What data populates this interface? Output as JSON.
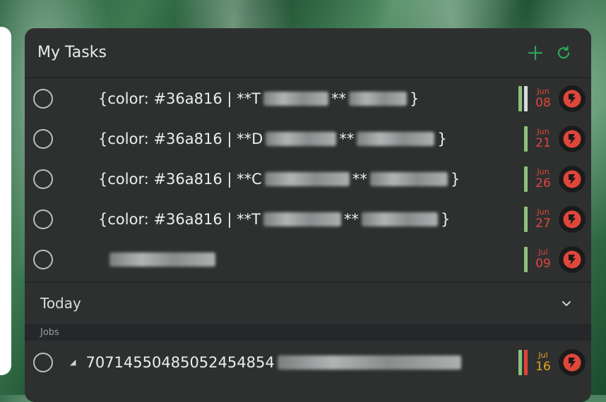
{
  "header": {
    "title": "My Tasks",
    "add_icon": "plus-icon",
    "refresh_icon": "refresh-icon",
    "accent": "#2aa65a"
  },
  "tasks": [
    {
      "text": "{color: #36a816 | **T",
      "text_end": "** ",
      "tail": "}",
      "month": "Jun",
      "day": "08",
      "date_color": "#e0463a",
      "bars": [
        "#8fc07c",
        "#d9dcdc"
      ]
    },
    {
      "text": "{color: #36a816 | **D",
      "text_end": "** ",
      "tail": "}",
      "month": "Jun",
      "day": "21",
      "date_color": "#e0463a",
      "bars": [
        "#8fc07c"
      ]
    },
    {
      "text": "{color: #36a816 | **C",
      "text_end": "** ",
      "tail": "}",
      "month": "Jun",
      "day": "26",
      "date_color": "#e0463a",
      "bars": [
        "#8fc07c"
      ]
    },
    {
      "text": "{color: #36a816 | **T",
      "text_end": "** ",
      "tail": "}",
      "month": "Jun",
      "day": "27",
      "date_color": "#e0463a",
      "bars": [
        "#8fc07c"
      ]
    },
    {
      "text": "",
      "text_end": "",
      "tail": "",
      "month": "Jul",
      "day": "09",
      "date_color": "#e0463a",
      "bars": [
        "#8fc07c"
      ]
    }
  ],
  "section": {
    "label": "Today",
    "chevron_icon": "chevron-down-icon"
  },
  "group": {
    "label": "Jobs"
  },
  "job": {
    "text": "70714550485052454854",
    "month": "Jul",
    "day": "16",
    "date_color": "#e2a61c",
    "bars": [
      "#8fc07c",
      "#e0463a"
    ]
  },
  "avatar_icon": "app-logo-icon"
}
